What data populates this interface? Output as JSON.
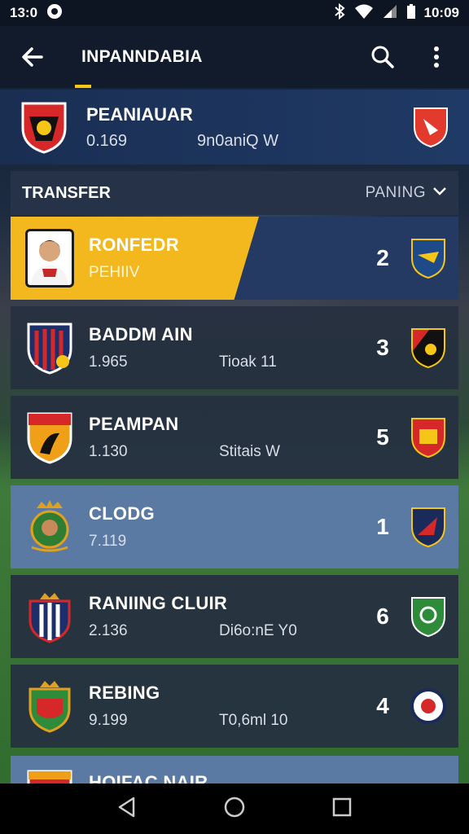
{
  "status_bar": {
    "left_time": "13:0",
    "right_time": "10:09"
  },
  "app_bar": {
    "title": "INPANNDABIA"
  },
  "header_card": {
    "name": "PEANIAUAR",
    "value": "0.169",
    "detail": "9n0aniQ W"
  },
  "section": {
    "title": "TRANSFER",
    "sort_label": "PANING"
  },
  "rows": [
    {
      "name": "RONFEDR",
      "value": "PEHIIV",
      "detail": "",
      "rank": "2"
    },
    {
      "name": "BADDM AIN",
      "value": "1.965",
      "detail": "Tioak 11",
      "rank": "3"
    },
    {
      "name": "PEAMPAN",
      "value": "1.130",
      "detail": "Stitais W",
      "rank": "5"
    },
    {
      "name": "CLODG",
      "value": "7.119",
      "detail": "",
      "rank": "1"
    },
    {
      "name": "RANIING CLUIR",
      "value": "2.136",
      "detail": "Di6o:nE Y0",
      "rank": "6"
    },
    {
      "name": "REBING",
      "value": "9.199",
      "detail": "T0,6ml 10",
      "rank": "4"
    }
  ],
  "partial_row": {
    "name": "HOIFAC NAIR"
  },
  "colors": {
    "accent": "#f2b81e",
    "app_bar": "#111b2b",
    "row_dark": "#263040",
    "row_light": "#5a7aa4"
  }
}
